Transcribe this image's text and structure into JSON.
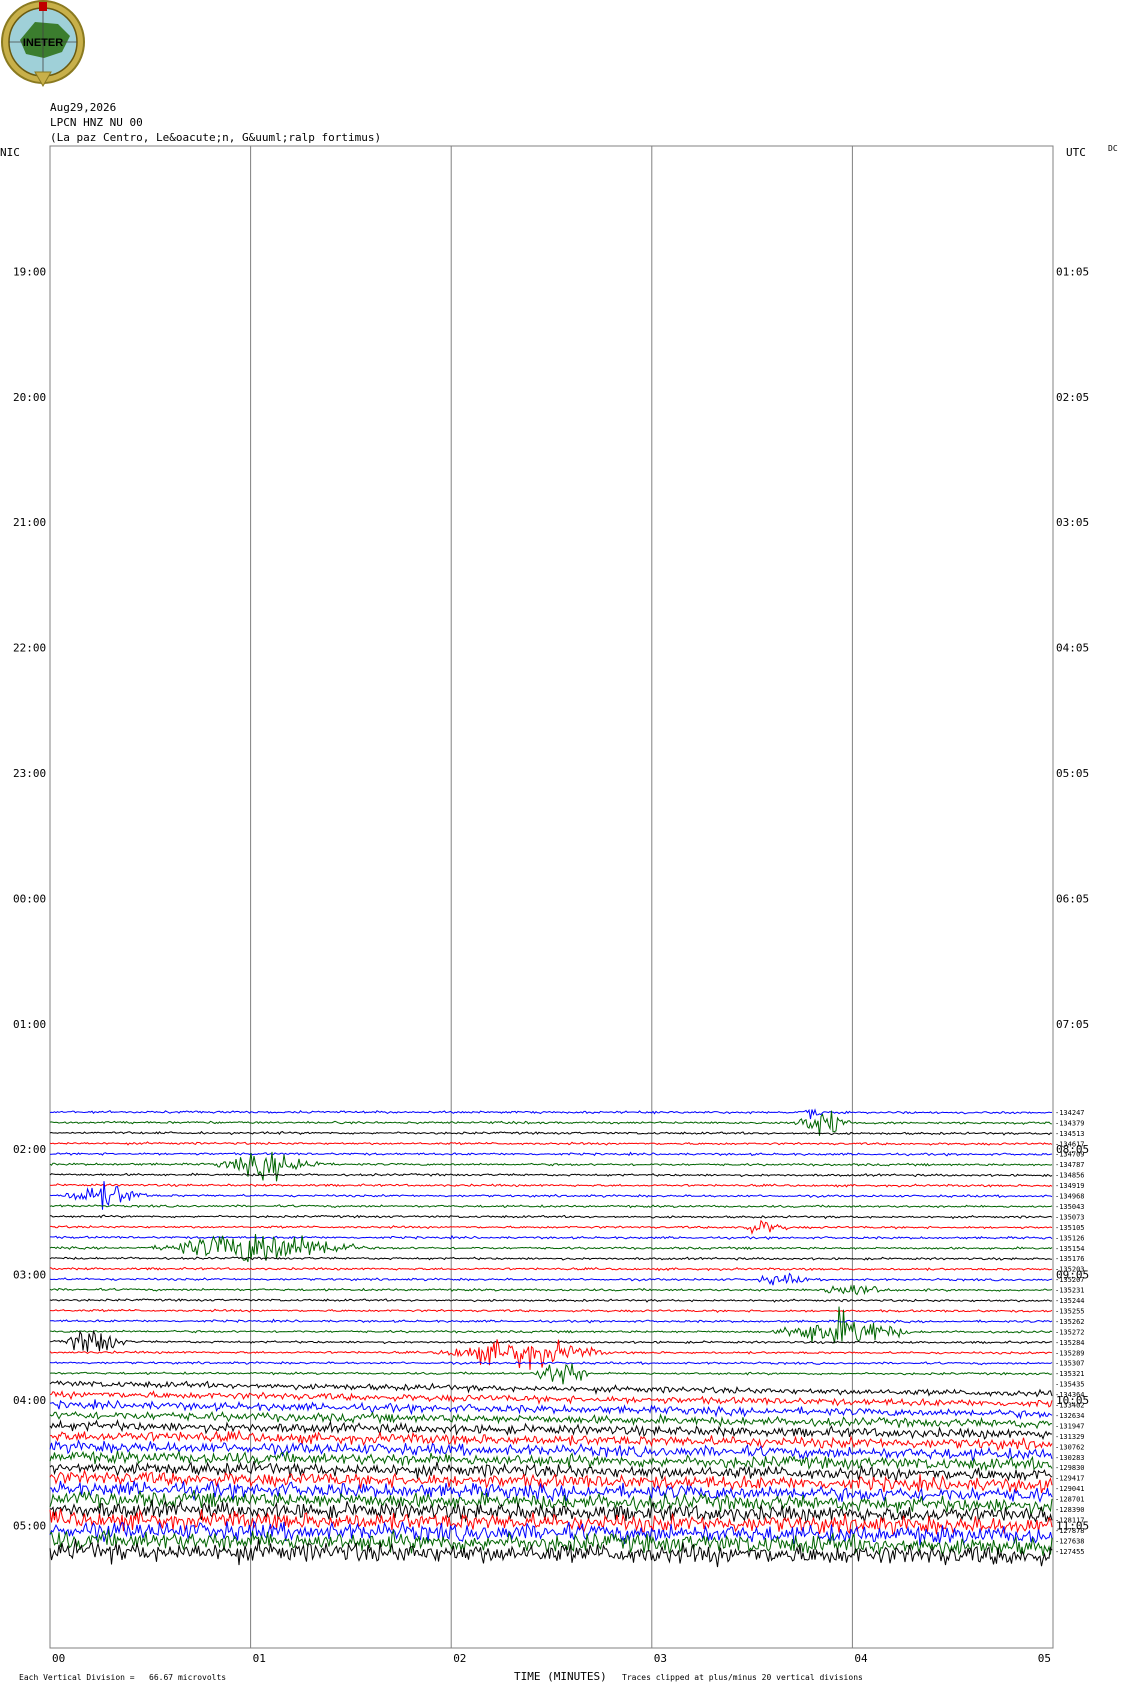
{
  "logo": {
    "text": "INETER",
    "icon": "ineter-logo-globe"
  },
  "header": {
    "date": "Aug29,2026",
    "station": "LPCN HNZ NU 00",
    "location": "(La paz Centro, Le&oacute;n, G&uuml;ralp fortimus)"
  },
  "left_axis_label": "NIC",
  "right_axis_label": "UTC",
  "dc_label": "DC",
  "left_hours": [
    "19:00",
    "20:00",
    "21:00",
    "22:00",
    "23:00",
    "00:00",
    "01:00",
    "02:00",
    "03:00",
    "04:00",
    "05:00"
  ],
  "right_hours": [
    "01:05",
    "02:05",
    "03:05",
    "04:05",
    "05:05",
    "06:05",
    "07:05",
    "08:05",
    "09:05",
    "10:05",
    "11:05"
  ],
  "x_ticks": [
    "00",
    "01",
    "02",
    "03",
    "04",
    "05"
  ],
  "footer": {
    "division": "Each Vertical Division =   66.67 microvolts",
    "xlabel": "TIME (MINUTES)",
    "clip": "Traces clipped at plus/minus 20 vertical divisions"
  },
  "colors": {
    "trace_cycle": [
      "#0000ff",
      "#006400",
      "#000000",
      "#ff0000"
    ],
    "grid": "#808080"
  },
  "chart_data": {
    "type": "line",
    "title": "",
    "xlabel": "TIME (MINUTES)",
    "ylabel": "",
    "xlim": [
      0,
      5
    ],
    "x_minor_step_minutes": 1,
    "trace_interval_minutes": 5,
    "first_trace_time_nic": "02:05",
    "dc_offsets": [
      -134247,
      -134379,
      -134513,
      -134617,
      -134709,
      -134787,
      -134856,
      -134919,
      -134968,
      -135043,
      -135073,
      -135105,
      -135126,
      -135154,
      -135176,
      -135203,
      -135207,
      -135231,
      -135244,
      -135255,
      -135262,
      -135272,
      -135284,
      -135289,
      -135307,
      -135321,
      -135435,
      -134364,
      -133402,
      -132634,
      -131947,
      -131329,
      -130762,
      -130283,
      -129830,
      -129417,
      -129041,
      -128701,
      -128390,
      -128117,
      -127878,
      -127638,
      -127455
    ],
    "events": [
      {
        "trace": 1,
        "start_min": 3.7,
        "end_min": 4.0,
        "amp": 2.2
      },
      {
        "trace": 0,
        "start_min": 3.75,
        "end_min": 3.85,
        "amp": 1.2
      },
      {
        "trace": 5,
        "start_min": 0.8,
        "end_min": 1.4,
        "amp": 1.8
      },
      {
        "trace": 8,
        "start_min": 0.05,
        "end_min": 0.5,
        "amp": 1.8
      },
      {
        "trace": 13,
        "start_min": 0.5,
        "end_min": 1.6,
        "amp": 2.6
      },
      {
        "trace": 11,
        "start_min": 3.4,
        "end_min": 3.7,
        "amp": 0.9
      },
      {
        "trace": 16,
        "start_min": 3.5,
        "end_min": 3.8,
        "amp": 0.8
      },
      {
        "trace": 17,
        "start_min": 3.8,
        "end_min": 4.2,
        "amp": 1.0
      },
      {
        "trace": 21,
        "start_min": 3.6,
        "end_min": 4.3,
        "amp": 2.5
      },
      {
        "trace": 22,
        "start_min": 0.05,
        "end_min": 0.4,
        "amp": 2.0
      },
      {
        "trace": 23,
        "start_min": 1.9,
        "end_min": 2.8,
        "amp": 2.0
      },
      {
        "trace": 25,
        "start_min": 2.4,
        "end_min": 2.7,
        "amp": 2.2
      }
    ]
  }
}
